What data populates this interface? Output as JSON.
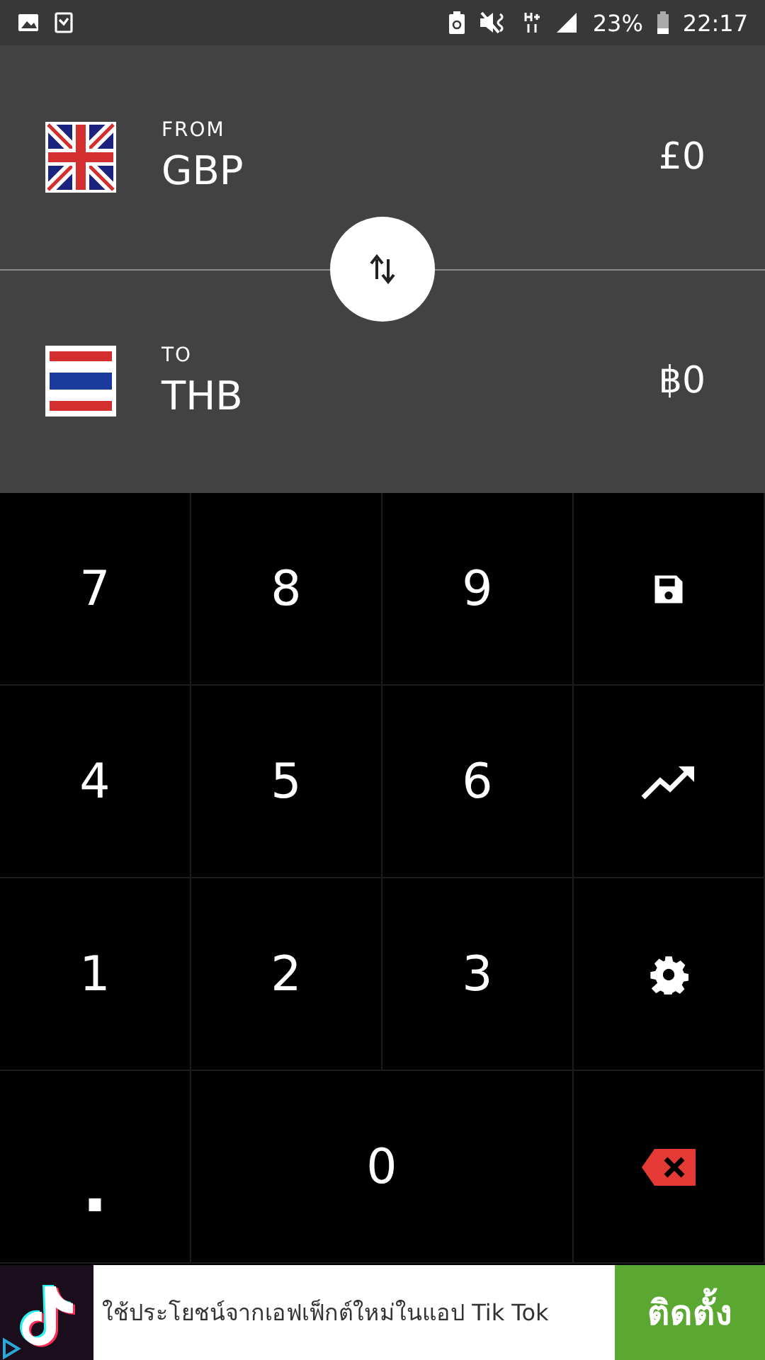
{
  "status_bar": {
    "battery_percent": "23%",
    "time": "22:17"
  },
  "currencies": [
    {
      "kind": "uk",
      "label": "FROM",
      "code": "GBP",
      "amount": "£0"
    },
    {
      "kind": "thai",
      "label": "TO",
      "code": "THB",
      "amount": "฿0"
    }
  ],
  "keypad": [
    {
      "kind": "digit",
      "label": "7"
    },
    {
      "kind": "digit",
      "label": "8"
    },
    {
      "kind": "digit",
      "label": "9"
    },
    {
      "kind": "save"
    },
    {
      "kind": "digit",
      "label": "4"
    },
    {
      "kind": "digit",
      "label": "5"
    },
    {
      "kind": "digit",
      "label": "6"
    },
    {
      "kind": "chart"
    },
    {
      "kind": "digit",
      "label": "1"
    },
    {
      "kind": "digit",
      "label": "2"
    },
    {
      "kind": "digit",
      "label": "3"
    },
    {
      "kind": "settings"
    },
    {
      "kind": "dot",
      "label": "."
    },
    {
      "kind": "wide",
      "label": "0"
    },
    {
      "kind": "backspace"
    }
  ],
  "ad": {
    "text": "ใช้ประโยชน์จากเอฟเฟ็กต์ใหม่ในแอป Tik Tok",
    "button": "ติดตั้ง"
  }
}
